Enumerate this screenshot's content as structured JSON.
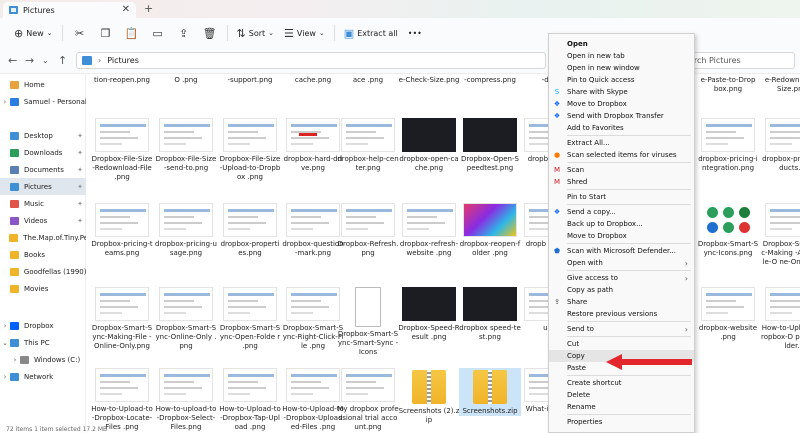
{
  "tab": {
    "title": "Pictures",
    "close": "✕",
    "new": "+"
  },
  "toolbar": {
    "new_label": "New",
    "sort_label": "Sort",
    "view_label": "View",
    "extract_label": "Extract all",
    "more": "•••"
  },
  "address": {
    "location": "Pictures",
    "search_placeholder": "Search Pictures"
  },
  "sidebar": [
    {
      "label": "Home",
      "icon": "home-icon",
      "color": "#e8a23d",
      "pin": false,
      "chev": ""
    },
    {
      "label": "Samuel - Personal",
      "icon": "cloud-icon",
      "color": "#2a7de1",
      "pin": false,
      "chev": "›"
    },
    {
      "label": "Desktop",
      "icon": "desktop-icon",
      "color": "#3f8fd7",
      "pin": true,
      "chev": ""
    },
    {
      "label": "Downloads",
      "icon": "download-icon",
      "color": "#2b9e5b",
      "pin": true,
      "chev": ""
    },
    {
      "label": "Documents",
      "icon": "document-icon",
      "color": "#5b7fb5",
      "pin": true,
      "chev": ""
    },
    {
      "label": "Pictures",
      "icon": "pictures-icon",
      "color": "#3f8fd7",
      "pin": true,
      "chev": "",
      "selected": true
    },
    {
      "label": "Music",
      "icon": "music-icon",
      "color": "#e0544a",
      "pin": true,
      "chev": ""
    },
    {
      "label": "Videos",
      "icon": "video-icon",
      "color": "#8a56c8",
      "pin": true,
      "chev": ""
    },
    {
      "label": "The.Map.of.Tiny.Per",
      "icon": "folder-icon",
      "color": "#f0b429",
      "pin": false,
      "chev": ""
    },
    {
      "label": "Books",
      "icon": "folder-icon",
      "color": "#f0b429",
      "pin": false,
      "chev": ""
    },
    {
      "label": "Goodfellas (1990)",
      "icon": "folder-icon",
      "color": "#f0b429",
      "pin": false,
      "chev": ""
    },
    {
      "label": "Movies",
      "icon": "folder-icon",
      "color": "#f0b429",
      "pin": false,
      "chev": ""
    },
    {
      "label": "Dropbox",
      "icon": "dropbox-icon",
      "color": "#0061fe",
      "pin": false,
      "chev": "›"
    },
    {
      "label": "This PC",
      "icon": "pc-icon",
      "color": "#3f8fd7",
      "pin": false,
      "chev": "⌄"
    },
    {
      "label": "Windows (C:)",
      "icon": "drive-icon",
      "color": "#888888",
      "pin": false,
      "chev": "›"
    },
    {
      "label": "Network",
      "icon": "network-icon",
      "color": "#3f8fd7",
      "pin": false,
      "chev": "›"
    }
  ],
  "top_row": [
    "tion-reopen.png",
    "O .png",
    "-support.png",
    "cache.png",
    "ace .png",
    "e-Check-Size.png",
    "-compress.png",
    "-drop",
    "",
    "e-Paste-to-Drop box.png",
    "e-Redownload -Size.png"
  ],
  "rows": [
    [
      {
        "name": "Dropbox-File-Size-Redownload-File .png",
        "t": "plain"
      },
      {
        "name": "Dropbox-File-Size-send-to.png",
        "t": "plain"
      },
      {
        "name": "Dropbox-File-Size-Upload-to-Dropbox .png",
        "t": "plain"
      },
      {
        "name": "dropbox-hard-drive.png",
        "t": "redarrow"
      },
      {
        "name": "dropbox-help-center.png",
        "t": "plain"
      },
      {
        "name": "dropbox-open-cache.png",
        "t": "dark"
      },
      {
        "name": "Dropbox-Open-Speedtest.png",
        "t": "dark"
      },
      {
        "name": "dropb d-supp",
        "t": "plain"
      },
      {
        "name": "",
        "t": "none"
      },
      {
        "name": "dropbox-pricing-integration.png",
        "t": "plain"
      },
      {
        "name": "dropbox-prici products.p",
        "t": "plain"
      }
    ],
    [
      {
        "name": "Dropbox-pricing-teams.png",
        "t": "plain"
      },
      {
        "name": "dropbox-pricing-usage.png",
        "t": "plain"
      },
      {
        "name": "dropbox-properties.png",
        "t": "plain"
      },
      {
        "name": "dropbox-question-mark.png",
        "t": "plain"
      },
      {
        "name": "Dropbox-Refresh. png",
        "t": "plain"
      },
      {
        "name": "dropbox-refresh-website .png",
        "t": "plain"
      },
      {
        "name": "dropbox-reopen-folder .png",
        "t": "colorful"
      },
      {
        "name": "dropb applicat",
        "t": "plain"
      },
      {
        "name": "",
        "t": "none"
      },
      {
        "name": "Dropbox-Smart-Sync-Icons.png",
        "t": "icons"
      },
      {
        "name": "Dropbox-Sm Sync-Making -Available-O ne-Only.png",
        "t": "plain"
      }
    ],
    [
      {
        "name": "Dropbox-Smart-Sync-Making-File -Online-Only.png",
        "t": "plain"
      },
      {
        "name": "Dropbox-Smart-Sync-Online-Only .png",
        "t": "plain"
      },
      {
        "name": "Dropbox-Smart-Sync-Open-Folde r .png",
        "t": "plain"
      },
      {
        "name": "Dropbox-Smart-Sync-Right-Click-File .png",
        "t": "plain"
      },
      {
        "name": "Dropbox-Smart-Sync-Smart-Sync -Icons",
        "t": "doc"
      },
      {
        "name": "Dropbox-Speed-Result .png",
        "t": "dark"
      },
      {
        "name": "dropbox speed-test.png",
        "t": "dark"
      },
      {
        "name": "ult.p",
        "t": "plain"
      },
      {
        "name": "",
        "t": "none"
      },
      {
        "name": "dropbox-website .png",
        "t": "plain"
      },
      {
        "name": "How-to-Uplo to-Dropbox-D pbox-Folder.",
        "t": "plain"
      }
    ],
    [
      {
        "name": "How-to-Upload-to-Dropbox-Locate-Files .png",
        "t": "plain"
      },
      {
        "name": "How-to-upload-to-Dropbox-Select-Files.png",
        "t": "plain"
      },
      {
        "name": "How-to-Upload-to-Dropbox-Tap-Upload .png",
        "t": "plain"
      },
      {
        "name": "How-to-Upload-to-Dropbox-Uploaded-Files .png",
        "t": "plain"
      },
      {
        "name": "My dropbox professional trial account.png",
        "t": "plain"
      },
      {
        "name": "Screenshots (2).zip",
        "t": "zip"
      },
      {
        "name": "Screenshots.zip",
        "t": "zip",
        "selected": true
      },
      {
        "name": "What-is - Pape",
        "t": "plain"
      }
    ]
  ],
  "menu": [
    {
      "label": "Open",
      "bold": true,
      "icon": "",
      "sub": false
    },
    {
      "label": "Open in new tab",
      "icon": "",
      "sub": false
    },
    {
      "label": "Open in new window",
      "icon": "",
      "sub": false
    },
    {
      "label": "Pin to Quick access",
      "icon": "",
      "sub": false
    },
    {
      "label": "Share with Skype",
      "icon": "skype-icon",
      "sub": false
    },
    {
      "label": "Move to Dropbox",
      "icon": "dropbox-icon",
      "sub": false
    },
    {
      "label": "Send with Dropbox Transfer",
      "icon": "dropbox-icon",
      "sub": false
    },
    {
      "label": "Add to Favorites",
      "icon": "",
      "sub": false
    },
    {
      "sep": true
    },
    {
      "label": "Extract All...",
      "icon": "",
      "sub": false
    },
    {
      "label": "Scan selected items for viruses",
      "icon": "avast-icon",
      "sub": false
    },
    {
      "sep": true
    },
    {
      "label": "Scan",
      "icon": "mcafee-icon",
      "sub": false
    },
    {
      "label": "Shred",
      "icon": "mcafee-icon",
      "sub": false
    },
    {
      "sep": true
    },
    {
      "label": "Pin to Start",
      "icon": "",
      "sub": false
    },
    {
      "sep": true
    },
    {
      "label": "Send a copy...",
      "icon": "dropbox-icon",
      "sub": false
    },
    {
      "label": "Back up to Dropbox...",
      "icon": "",
      "sub": false
    },
    {
      "label": "Move to Dropbox",
      "icon": "",
      "sub": false
    },
    {
      "sep": true
    },
    {
      "label": "Scan with Microsoft Defender...",
      "icon": "defender-icon",
      "sub": false
    },
    {
      "label": "Open with",
      "icon": "",
      "sub": true
    },
    {
      "sep": true
    },
    {
      "label": "Give access to",
      "icon": "",
      "sub": true
    },
    {
      "label": "Copy as path",
      "icon": "",
      "sub": false
    },
    {
      "label": "Share",
      "icon": "share-icon",
      "sub": false
    },
    {
      "label": "Restore previous versions",
      "icon": "",
      "sub": false
    },
    {
      "sep": true
    },
    {
      "label": "Send to",
      "icon": "",
      "sub": true
    },
    {
      "sep": true
    },
    {
      "label": "Cut",
      "icon": "",
      "sub": false
    },
    {
      "label": "Copy",
      "icon": "",
      "sub": false,
      "hl": true
    },
    {
      "label": "Paste",
      "icon": "",
      "sub": false
    },
    {
      "sep": true
    },
    {
      "label": "Create shortcut",
      "icon": "",
      "sub": false
    },
    {
      "label": "Delete",
      "icon": "",
      "sub": false
    },
    {
      "label": "Rename",
      "icon": "",
      "sub": false
    },
    {
      "sep": true
    },
    {
      "label": "Properties",
      "icon": "",
      "sub": false
    }
  ],
  "status": {
    "text": "72 items  1 item selected 17.2 MB"
  },
  "colors": {
    "arrow": "#e3262b",
    "accent": "#3f8fd7",
    "selection": "#cce4f7"
  }
}
